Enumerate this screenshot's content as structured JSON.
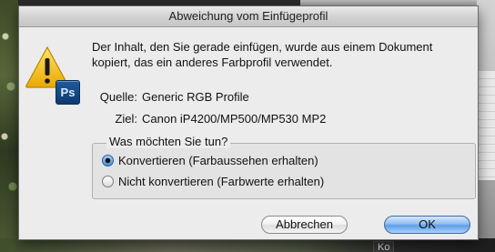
{
  "background": {
    "corner_tab_label": "Ko"
  },
  "dialog": {
    "title": "Abweichung vom Einfügeprofil",
    "icon": "caution-icon",
    "app_badge": "Ps",
    "message": "Der Inhalt, den Sie gerade einfügen, wurde aus einem Dokument kopiert, das ein anderes Farbprofil verwendet.",
    "source": {
      "label": "Quelle:",
      "value": "Generic RGB Profile"
    },
    "target": {
      "label": "Ziel:",
      "value": "Canon iP4200/MP500/MP530 MP2"
    },
    "options": {
      "title": "Was möchten Sie tun?",
      "items": [
        {
          "label": "Konvertieren (Farbaussehen erhalten)",
          "selected": true
        },
        {
          "label": "Nicht konvertieren (Farbwerte erhalten)",
          "selected": false
        }
      ]
    },
    "buttons": {
      "cancel_label": "Abbrechen",
      "ok_label": "OK"
    }
  },
  "colors": {
    "accent": "#5f9ee8",
    "caution_yellow": "#f3c316",
    "ps_blue": "#1d5a9e"
  }
}
